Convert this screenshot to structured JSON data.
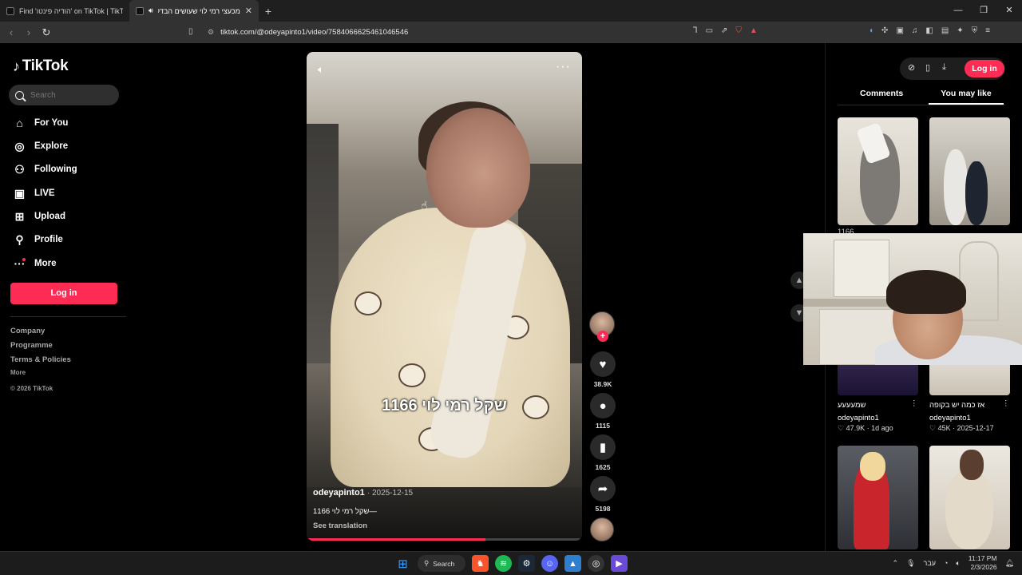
{
  "browser": {
    "tabs": [
      {
        "title": "Find 'הודיה פינטו' on TikTok | TikTok S",
        "active": false
      },
      {
        "title": "מכעצי רמי לוי שעושים הבדל :",
        "active": true
      }
    ],
    "url": "tiktok.com/@odeyapinto1/video/7584066625461046546"
  },
  "sidebar": {
    "logo": "TikTok",
    "search_placeholder": "Search",
    "items": [
      {
        "label": "For You",
        "icon": "home-icon"
      },
      {
        "label": "Explore",
        "icon": "compass-icon"
      },
      {
        "label": "Following",
        "icon": "following-icon"
      },
      {
        "label": "LIVE",
        "icon": "live-icon"
      },
      {
        "label": "Upload",
        "icon": "upload-icon"
      },
      {
        "label": "Profile",
        "icon": "profile-icon"
      },
      {
        "label": "More",
        "icon": "more-icon"
      }
    ],
    "login": "Log in",
    "footer": {
      "company": "Company",
      "programme": "Programme",
      "terms": "Terms & Policies",
      "more": "More",
      "copyright": "© 2026 TikTok"
    }
  },
  "video": {
    "caption_overlay": "1166 שקל רמי לוי",
    "author": "odeyapinto1",
    "date": "· 2025-12-15",
    "description": "1166 שקל רמי לוי—",
    "see_translation": "See translation",
    "progress": 0.65
  },
  "actions": {
    "likes": "38.9K",
    "comments": "1115",
    "saves": "1625",
    "shares": "5198"
  },
  "right_panel": {
    "login": "Log in",
    "tabs": [
      "Comments",
      "You may like"
    ],
    "active_tab": "You may like",
    "cards": [
      {
        "title": "שמעעעע",
        "author": "odeyapinto1",
        "likes": "47.9K",
        "age": "1d ago"
      },
      {
        "title": "אז כמה יש בקופה",
        "author": "odeyapinto1",
        "likes": "45K",
        "age": "2025-12-17"
      }
    ],
    "partial_label": "1166"
  },
  "taskbar": {
    "search": "Search",
    "language": "עבר",
    "time": "11:17 PM",
    "date": "2/3/2026"
  },
  "colors": {
    "accent": "#fe2c55",
    "background": "#000000"
  }
}
